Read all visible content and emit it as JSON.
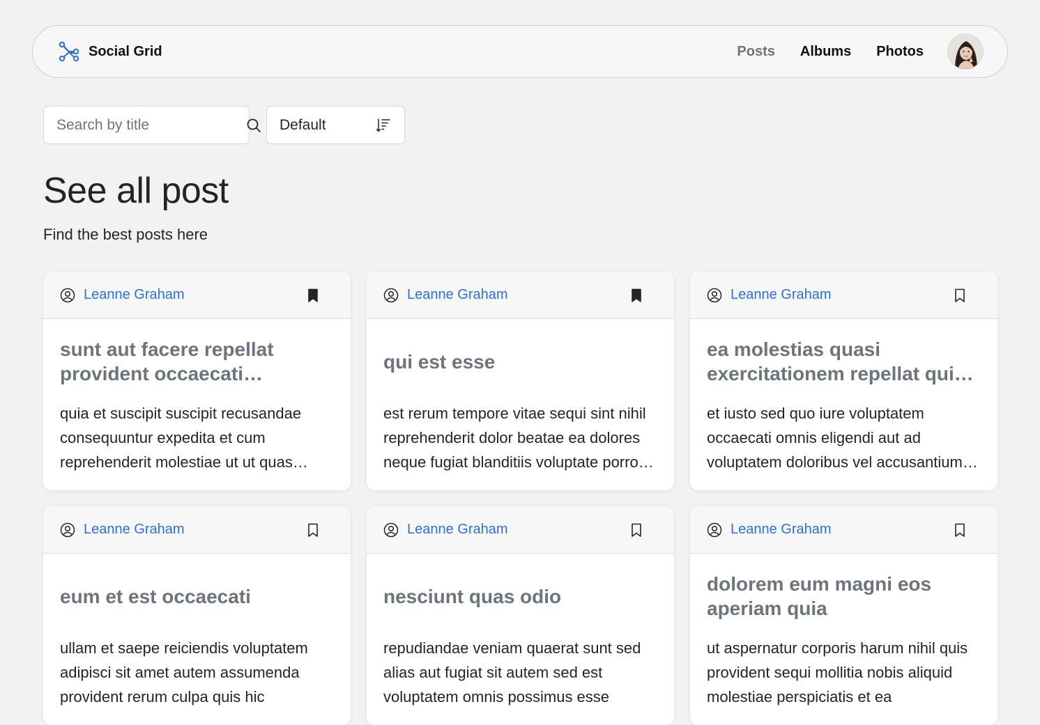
{
  "navbar": {
    "brand": "Social Grid",
    "links": [
      "Posts",
      "Albums",
      "Photos"
    ],
    "brand_icon": "share-nodes-icon",
    "avatar_icon": "user-avatar"
  },
  "toolbar": {
    "search_placeholder": "Search by title",
    "sort_label": "Default",
    "search_icon": "search-icon",
    "sort_icon": "sort-descending-icon"
  },
  "page": {
    "title": "See all post",
    "subtitle": "Find the best posts here"
  },
  "colors": {
    "accent": "#2f6fe0",
    "background": "#f2f2f2",
    "muted": "#6c757d"
  },
  "posts": [
    {
      "author": "Leanne Graham",
      "bookmarked": true,
      "title": "sunt aut facere repellat provident occaecati excepturi optio reprehenderit",
      "body": "quia et suscipit suscipit recusandae consequuntur expedita et cum reprehenderit molestiae ut ut quas totam nostrum rerum est autem sunt rem eveniet architecto"
    },
    {
      "author": "Leanne Graham",
      "bookmarked": true,
      "title": "qui est esse",
      "body": "est rerum tempore vitae sequi sint nihil reprehenderit dolor beatae ea dolores neque fugiat blanditiis voluptate porro vel nihil molestiae ut reiciendis"
    },
    {
      "author": "Leanne Graham",
      "bookmarked": false,
      "title": "ea molestias quasi exercitationem repellat qui ipsa sit aut",
      "body": "et iusto sed quo iure voluptatem occaecati omnis eligendi aut ad voluptatem doloribus vel accusantium quis pariatur molestiae porro eius odio et labore"
    },
    {
      "author": "Leanne Graham",
      "bookmarked": false,
      "title": "eum et est occaecati",
      "body": "ullam et saepe reiciendis voluptatem adipisci sit amet autem assumenda provident rerum culpa quis hic"
    },
    {
      "author": "Leanne Graham",
      "bookmarked": false,
      "title": "nesciunt quas odio",
      "body": "repudiandae veniam quaerat sunt sed alias aut fugiat sit autem sed est voluptatem omnis possimus esse"
    },
    {
      "author": "Leanne Graham",
      "bookmarked": false,
      "title": "dolorem eum magni eos aperiam quia",
      "body": "ut aspernatur corporis harum nihil quis provident sequi mollitia nobis aliquid molestiae perspiciatis et ea"
    }
  ]
}
